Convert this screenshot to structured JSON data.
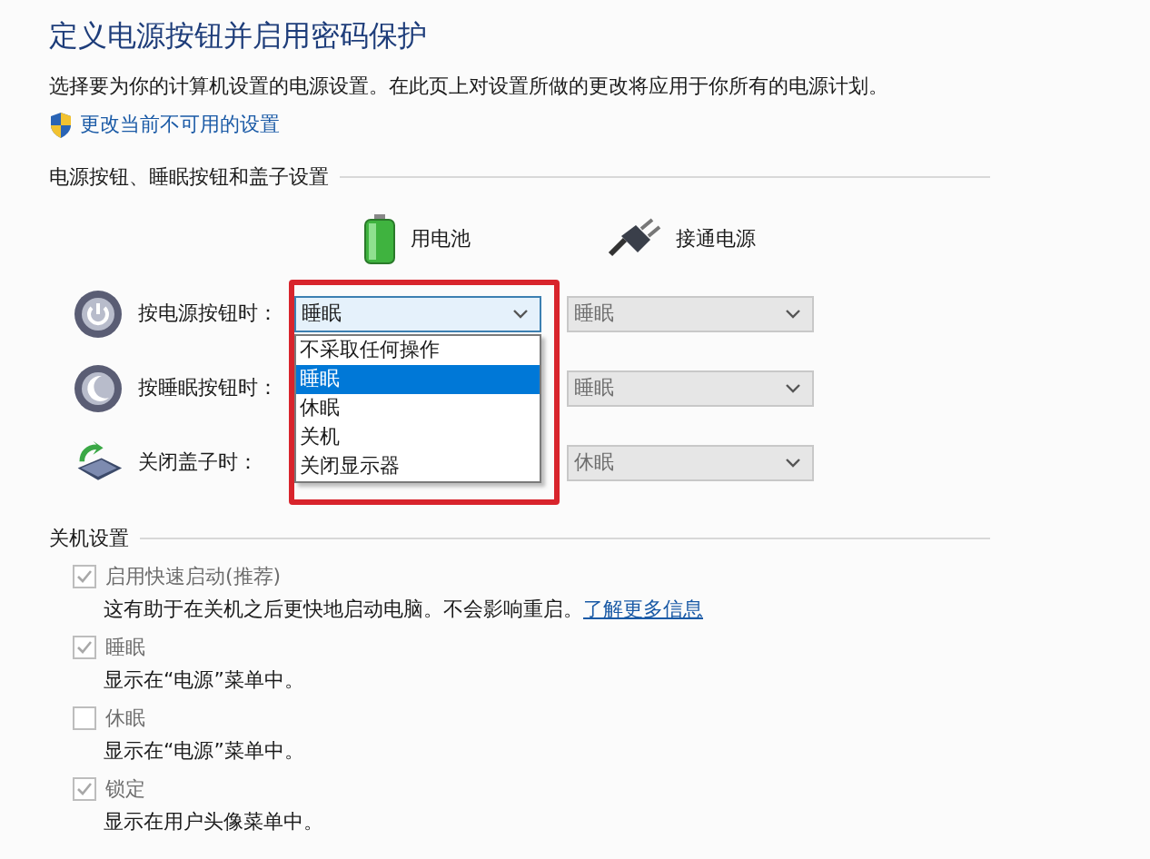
{
  "title": "定义电源按钮并启用密码保护",
  "description": "选择要为你的计算机设置的电源设置。在此页上对设置所做的更改将应用于你所有的电源计划。",
  "admin_link": "更改当前不可用的设置",
  "power_section": {
    "heading": "电源按钮、睡眠按钮和盖子设置",
    "columns": [
      {
        "label": "用电池",
        "kind": "battery"
      },
      {
        "label": "接通电源",
        "kind": "plug"
      }
    ],
    "rows": [
      {
        "kind": "power",
        "label": "按电源按钮时：",
        "on_battery": {
          "value": "睡眠",
          "expanded": true,
          "highlighted": true
        },
        "plugged_in": {
          "value": "睡眠",
          "disabled": true
        }
      },
      {
        "kind": "sleep",
        "label": "按睡眠按钮时：",
        "plugged_in": {
          "value": "睡眠",
          "disabled": true
        }
      },
      {
        "kind": "lid",
        "label": "关闭盖子时：",
        "plugged_in": {
          "value": "休眠",
          "disabled": true
        }
      }
    ],
    "open_list": [
      {
        "label": "不采取任何操作",
        "selected": false
      },
      {
        "label": "睡眠",
        "selected": true
      },
      {
        "label": "休眠",
        "selected": false
      },
      {
        "label": "关机",
        "selected": false
      },
      {
        "label": "关闭显示器",
        "selected": false
      }
    ]
  },
  "shutdown_section": {
    "heading": "关机设置",
    "items": [
      {
        "label": "启用快速启动(推荐)",
        "checked": true,
        "disabled": true,
        "description": "这有助于在关机之后更快地启动电脑。不会影响重启。",
        "link": "了解更多信息"
      },
      {
        "label": "睡眠",
        "checked": true,
        "disabled": true,
        "description": "显示在“电源”菜单中。"
      },
      {
        "label": "休眠",
        "checked": false,
        "disabled": true,
        "description": "显示在“电源”菜单中。"
      },
      {
        "label": "锁定",
        "checked": true,
        "disabled": true,
        "description": "显示在用户头像菜单中。"
      }
    ]
  }
}
